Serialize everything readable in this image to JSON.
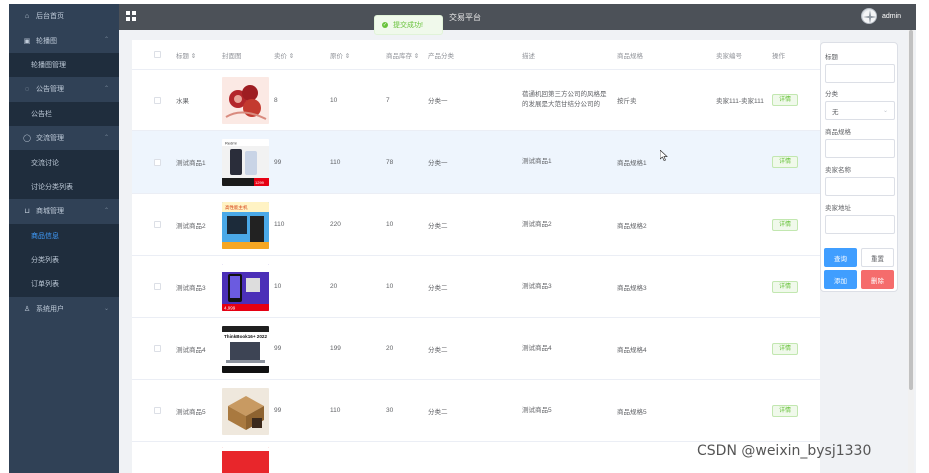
{
  "sidebar": {
    "items": [
      {
        "label": "后台首页",
        "icon": "home-icon",
        "type": "top",
        "arrow": ""
      },
      {
        "label": "轮播图",
        "icon": "picture-icon",
        "type": "group",
        "arrow": "⌃"
      },
      {
        "label": "轮播图管理",
        "icon": "",
        "type": "sub",
        "arrow": ""
      },
      {
        "label": "公告管理",
        "icon": "notice-icon",
        "type": "group",
        "arrow": "⌃"
      },
      {
        "label": "公告栏",
        "icon": "",
        "type": "sub",
        "arrow": ""
      },
      {
        "label": "交流管理",
        "icon": "chat-icon",
        "type": "group",
        "arrow": "⌃"
      },
      {
        "label": "交流讨论",
        "icon": "",
        "type": "sub",
        "arrow": ""
      },
      {
        "label": "讨论分类列表",
        "icon": "",
        "type": "sub",
        "arrow": ""
      },
      {
        "label": "商城管理",
        "icon": "cart-icon",
        "type": "group",
        "arrow": "⌃"
      },
      {
        "label": "商品信息",
        "icon": "",
        "type": "sub",
        "arrow": "",
        "active": true
      },
      {
        "label": "分类列表",
        "icon": "",
        "type": "sub",
        "arrow": ""
      },
      {
        "label": "订单列表",
        "icon": "",
        "type": "sub",
        "arrow": ""
      },
      {
        "label": "系统用户",
        "icon": "user-icon",
        "type": "group",
        "arrow": "⌄"
      }
    ]
  },
  "topbar": {
    "title": "交易平台",
    "username": "admin"
  },
  "toast": {
    "message": "提交成功!"
  },
  "table": {
    "headers": [
      "标题 ⇕",
      "封面图",
      "卖价 ⇕",
      "原价 ⇕",
      "商品库存 ⇕",
      "产品分类",
      "描述",
      "商品规格",
      "卖家编号",
      "操作"
    ],
    "detail_label": "详情",
    "rows": [
      {
        "title": "水果",
        "price": "8",
        "orig": "10",
        "stock": "7",
        "category": "分类一",
        "desc": "蓓通机回第三方公司的风格是的发展是大范甘结分公司的",
        "spec": "按斤卖",
        "seller": "卖家111-卖家111",
        "thumb": "fruit"
      },
      {
        "title": "测试商品1",
        "price": "99",
        "orig": "110",
        "stock": "78",
        "category": "分类一",
        "desc": "测试商品1",
        "spec": "商品规格1",
        "seller": "",
        "thumb": "phone"
      },
      {
        "title": "测试商品2",
        "price": "110",
        "orig": "220",
        "stock": "10",
        "category": "分类二",
        "desc": "测试商品2",
        "spec": "商品规格2",
        "seller": "",
        "thumb": "pc"
      },
      {
        "title": "测试商品3",
        "price": "10",
        "orig": "20",
        "stock": "10",
        "category": "分类二",
        "desc": "测试商品3",
        "spec": "商品规格3",
        "seller": "",
        "thumb": "phone2"
      },
      {
        "title": "测试商品4",
        "price": "99",
        "orig": "199",
        "stock": "20",
        "category": "分类二",
        "desc": "测试商品4",
        "spec": "商品规格4",
        "seller": "",
        "thumb": "laptop"
      },
      {
        "title": "测试商品5",
        "price": "99",
        "orig": "110",
        "stock": "30",
        "category": "分类二",
        "desc": "测试商品5",
        "spec": "商品规格5",
        "seller": "",
        "thumb": "box"
      }
    ]
  },
  "thumbs": {
    "phone_top": "Redmi",
    "phone_price": "1299",
    "pc_text": "高性能主机",
    "phone2_price": "4,999",
    "laptop_text": "ThinkBook16+ 2022"
  },
  "search_panel": {
    "title_label": "标题",
    "title_value": "",
    "category_label": "分类",
    "category_value": "无",
    "spec_label": "商品规格",
    "spec_value": "",
    "seller_label": "卖家名称",
    "seller_value": "",
    "address_label": "卖家地址",
    "address_value": "",
    "query_btn": "查询",
    "reset_btn": "重置",
    "add_btn": "添加",
    "delete_btn": "删除"
  },
  "watermark": "CSDN @weixin_bysj1330",
  "colors": {
    "sidebar_bg": "#304156",
    "topbar_bg": "#4c5158",
    "primary": "#409eff",
    "success": "#67c23a",
    "danger": "#f56c6c"
  }
}
